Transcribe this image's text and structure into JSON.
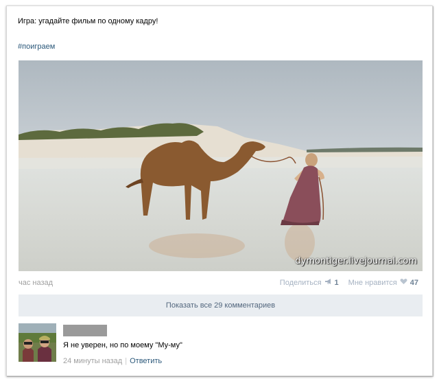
{
  "post": {
    "text": "Игра: угадайте фильм по одному кадру!",
    "hashtag": "#поиграем",
    "watermark": "dymontiger.livejournal.com",
    "time": "час назад"
  },
  "actions": {
    "share_label": "Поделиться",
    "share_count": "1",
    "like_label": "Мне нравится",
    "like_count": "47"
  },
  "comments_toggle": {
    "label": "Показать все 29 комментариев"
  },
  "comment": {
    "text": "Я не уверен, но по моему \"Му-му\"",
    "time": "24 минуты назад",
    "reply_label": "Ответить"
  },
  "colors": {
    "link": "#2b587a",
    "muted": "#a0a0a0",
    "action_muted": "#a6b2c2",
    "comments_bar_bg": "#e9edf1"
  },
  "icons": [
    "megaphone-icon",
    "heart-icon"
  ]
}
